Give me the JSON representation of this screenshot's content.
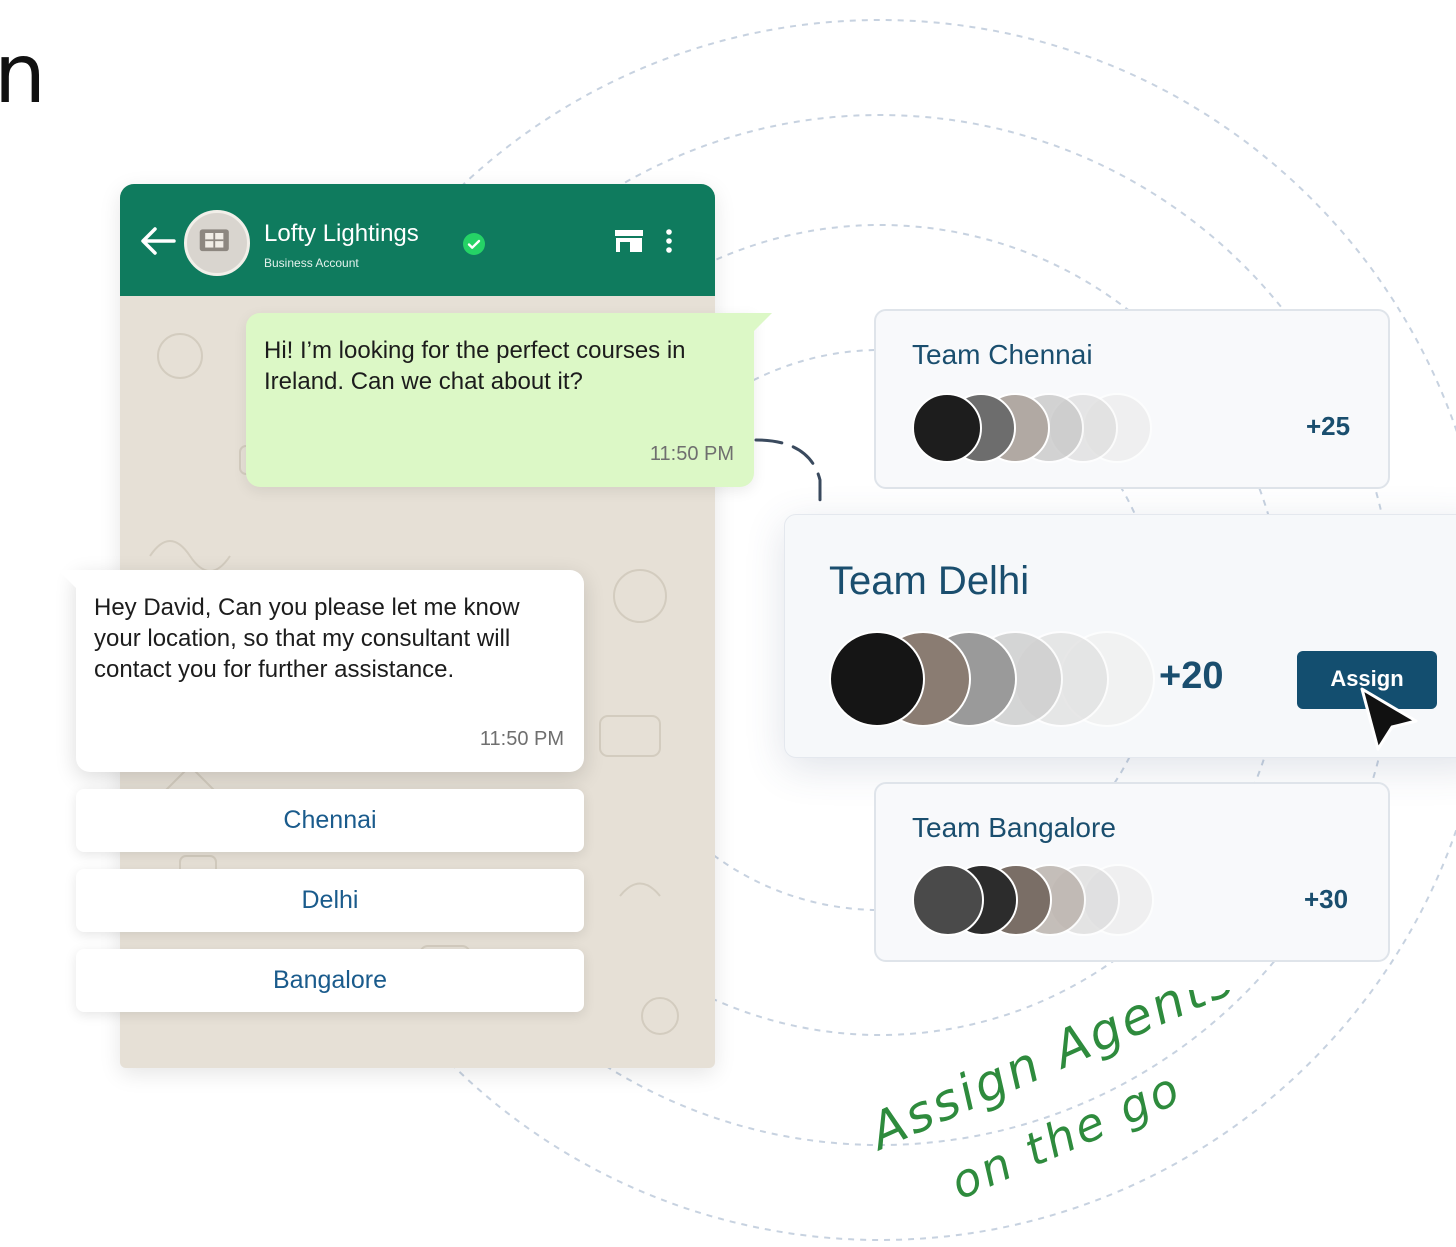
{
  "corner_glyph": "n",
  "chat": {
    "header": {
      "business_name": "Lofty Lightings",
      "business_subtitle": "Business Account",
      "accent_color": "#0f7b5e"
    },
    "outgoing": {
      "text": "Hi! I’m looking for the perfect courses in Ireland. Can we chat about it?",
      "time": "11:50 PM"
    },
    "incoming": {
      "text": "Hey David, Can you please let me know your location, so that my consultant will contact you for further assistance.",
      "time": "11:50 PM"
    },
    "options": [
      {
        "label": "Chennai"
      },
      {
        "label": "Delhi"
      },
      {
        "label": "Bangalore"
      }
    ]
  },
  "teams": [
    {
      "name": "Team Chennai",
      "count": "+25"
    },
    {
      "name": "Team Delhi",
      "count": "+20",
      "assign_label": "Assign"
    },
    {
      "name": "Team Bangalore",
      "count": "+30"
    }
  ],
  "tagline": {
    "line1": "Assign Agents",
    "line2": "on the go",
    "color": "#2e8b3d"
  }
}
